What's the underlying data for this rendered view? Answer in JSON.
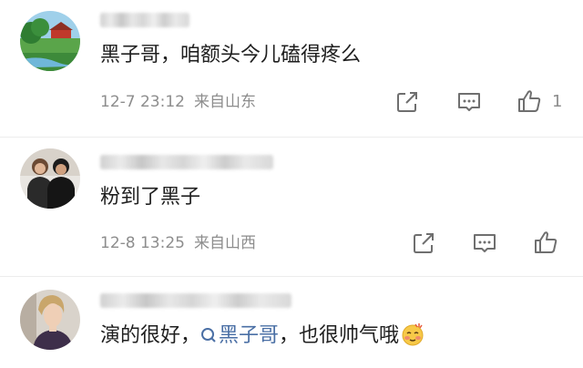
{
  "comments": [
    {
      "text": "黑子哥，咱额头今儿磕得疼么",
      "time": "12-7 23:12",
      "location": "来自山东",
      "like_count": "1",
      "avatar_icon": "landscape-avatar"
    },
    {
      "text": "粉到了黑子",
      "time": "12-8 13:25",
      "location": "来自山西",
      "avatar_icon": "people-avatar"
    },
    {
      "text_before": "演的很好，",
      "mention": "黑子哥",
      "text_after": "，也很帅气哦",
      "avatar_icon": "person-avatar",
      "emoji": "blushing-emoji"
    }
  ],
  "colors": {
    "mention": "#4a6fa5",
    "meta": "#8d8d8d",
    "text": "#1f1f1f"
  }
}
